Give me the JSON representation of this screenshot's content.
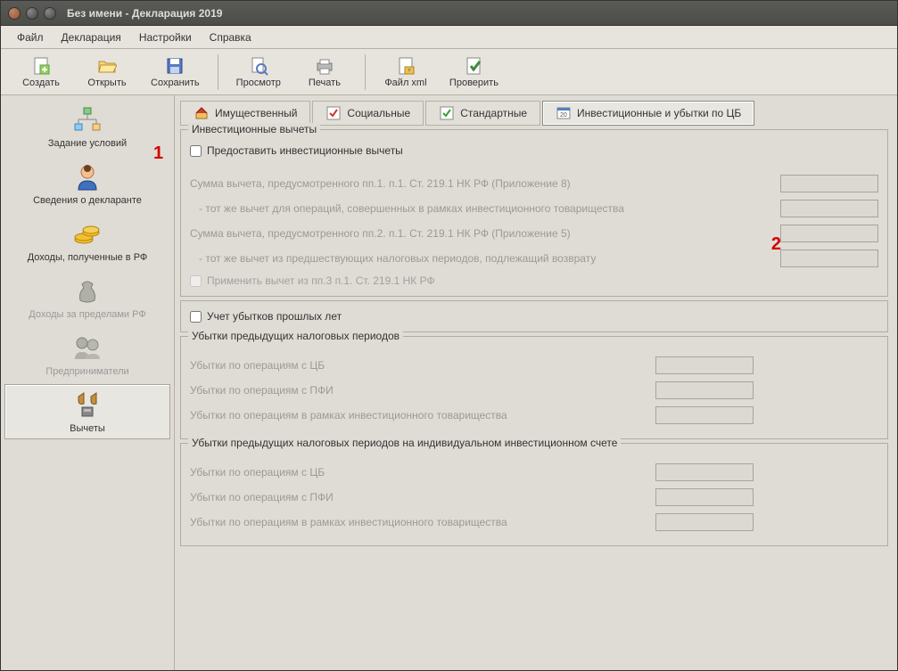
{
  "window": {
    "title": "Без имени - Декларация 2019"
  },
  "menubar": {
    "file": "Файл",
    "decl": "Декларация",
    "settings": "Настройки",
    "help": "Справка"
  },
  "toolbar": {
    "create": "Создать",
    "open": "Открыть",
    "save": "Сохранить",
    "preview": "Просмотр",
    "print": "Печать",
    "xml": "Файл xml",
    "check": "Проверить"
  },
  "sidebar": {
    "conditions": "Задание условий",
    "declarant": "Сведения о декларанте",
    "income_rf": "Доходы, полученные в РФ",
    "income_abroad": "Доходы за пределами РФ",
    "entrepreneurs": "Предприниматели",
    "deductions": "Вычеты"
  },
  "tabs": {
    "property": "Имущественный",
    "social": "Социальные",
    "standard": "Стандартные",
    "invest": "Инвестиционные и убытки по ЦБ"
  },
  "invest": {
    "legend": "Инвестиционные вычеты",
    "provide": "Предоставить инвестиционные вычеты",
    "row1": "Сумма вычета, предусмотренного пп.1. п.1. Ст. 219.1 НК РФ (Приложение 8)",
    "row2": " - тот же вычет для операций, совершенных в рамках инвестиционного товарищества",
    "row3": "Сумма вычета, предусмотренного пп.2. п.1. Ст. 219.1 НК РФ (Приложение 5)",
    "row4": " - тот же вычет из предшествующих налоговых периодов, подлежащий возврату",
    "apply": "Применить вычет из пп.3 п.1. Ст. 219.1 НК РФ"
  },
  "losses_check": "Учет убытков прошлых лет",
  "losses1": {
    "legend": "Убытки предыдущих налоговых периодов",
    "r1": "Убытки по операциям с ЦБ",
    "r2": "Убытки по операциям с ПФИ",
    "r3": "Убытки по операциям в рамках инвестиционного товарищества"
  },
  "losses2": {
    "legend": "Убытки предыдущих налоговых периодов на индивидуальном инвестиционном счете",
    "r1": "Убытки по операциям с ЦБ",
    "r2": "Убытки по операциям с ПФИ",
    "r3": "Убытки по операциям в рамках инвестиционного товарищества"
  },
  "annotations": {
    "a1": "1",
    "a2": "2"
  }
}
